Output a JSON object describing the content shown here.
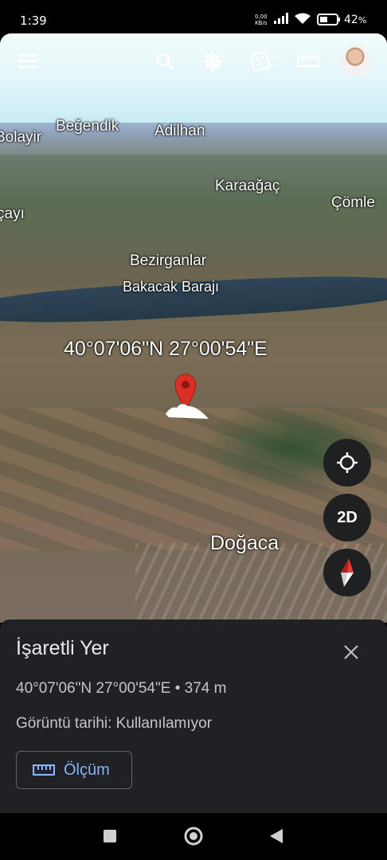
{
  "status_bar": {
    "time": "1:39",
    "net_speed_value": "0,00",
    "net_speed_unit": "KB/s",
    "battery_percent": "42",
    "battery_unit": "%"
  },
  "toolbar": {
    "icons": [
      "menu-icon",
      "search-icon",
      "voyager-wheel-icon",
      "random-dice-icon",
      "ruler-icon",
      "avatar"
    ]
  },
  "map": {
    "labels": {
      "bolayir": "Bolayir",
      "begendik": "Beğendik",
      "adilhan": "Adilhan",
      "karaagac": "Karaağaç",
      "comle": "Çömle",
      "cayi": "çayı",
      "bezirganlar": "Bezirganlar",
      "bakacak": "Bakacak Barajı",
      "dogaca": "Doğaca"
    },
    "coordinate_label": "40°07'06\"N 27°00'54\"E"
  },
  "fabs": {
    "mode_label": "2D"
  },
  "sheet": {
    "title": "İşaretli Yer",
    "coordinates": "40°07'06\"N 27°00'54\"E • 374 m",
    "imagery_date": "Görüntü tarihi: Kullanılamıyor",
    "measure_label": "Ölçüm"
  },
  "colors": {
    "accent_blue": "#8ab4f8",
    "pin_red": "#d93025",
    "sheet_bg": "#202124"
  }
}
